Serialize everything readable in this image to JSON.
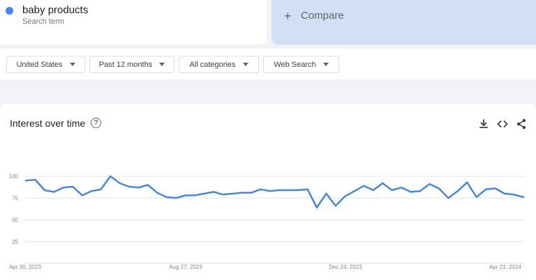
{
  "search": {
    "term": "baby products",
    "term_type": "Search term",
    "term_color": "#4285f4",
    "compare_label": "Compare",
    "compare_icon": "plus-icon"
  },
  "filters": {
    "region": "United States",
    "time_range": "Past 12 months",
    "category": "All categories",
    "search_type": "Web Search"
  },
  "panel": {
    "title": "Interest over time",
    "icons": [
      "help-icon",
      "download-icon",
      "embed-icon",
      "share-icon"
    ]
  },
  "chart_data": {
    "type": "line",
    "title": "Interest over time",
    "y_ticks": [
      100,
      75,
      50,
      25
    ],
    "ylim": [
      0,
      100
    ],
    "x_ticks": [
      "Apr 30, 2023",
      "Aug 27, 2023",
      "Dec 24, 2023",
      "Apr 21, 2024"
    ],
    "grid": true,
    "series": [
      {
        "name": "baby products",
        "color": "#4a86d8",
        "values": [
          95,
          96,
          84,
          82,
          87,
          88,
          78,
          83,
          85,
          100,
          92,
          88,
          87,
          90,
          81,
          76,
          75,
          78,
          78,
          80,
          82,
          79,
          80,
          81,
          81,
          85,
          83,
          84,
          84,
          84,
          85,
          64,
          80,
          66,
          77,
          83,
          89,
          84,
          92,
          84,
          87,
          82,
          83,
          91,
          86,
          75,
          83,
          93,
          76,
          85,
          86,
          80,
          79,
          76
        ]
      }
    ]
  }
}
